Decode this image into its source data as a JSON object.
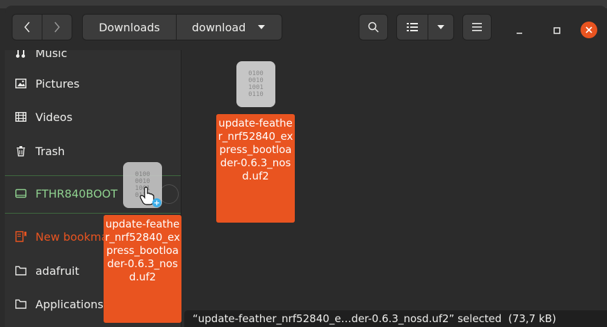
{
  "window": {
    "nav": {
      "back_icon": "chevron-left-icon",
      "forward_icon": "chevron-right-icon"
    },
    "breadcrumb": {
      "crumb1": "Downloads",
      "crumb2": "download"
    },
    "toolbar": {
      "search_icon": "search-icon",
      "view_icon": "list-view-icon",
      "menu_icon": "hamburger-menu-icon"
    },
    "window_controls": {
      "minimize": "minimize-icon",
      "maximize": "maximize-icon",
      "close": "close-icon"
    }
  },
  "sidebar": {
    "items": [
      {
        "label": "Music",
        "icon": "music-icon"
      },
      {
        "label": "Pictures",
        "icon": "pictures-icon"
      },
      {
        "label": "Videos",
        "icon": "videos-icon"
      },
      {
        "label": "Trash",
        "icon": "trash-icon"
      },
      {
        "label": "FTHR840BOOT",
        "icon": "drive-icon"
      },
      {
        "label": "New bookmark",
        "icon": "bookmark-icon"
      },
      {
        "label": "adafruit",
        "icon": "folder-icon"
      },
      {
        "label": "Applications",
        "icon": "folder-icon"
      }
    ]
  },
  "content": {
    "file": {
      "glyph": "0100\n0010\n1001\n0110",
      "label": "update-feather_nrf52840_express_bootloader-0.6.3_nosd.uf2"
    }
  },
  "drag": {
    "glyph": "0100\n0010\n1001\n0110",
    "label": "update-feather_nrf52840_express_bootloader-0.6.3_nosd.uf2",
    "badge": "+"
  },
  "statusbar": {
    "text": "“update-feather_nrf52840_e…der-0.6.3_nosd.uf2” selected  (73,7 kB)"
  },
  "colors": {
    "accent": "#e95420",
    "bg": "#2b2b2b",
    "sidebar": "#303030"
  }
}
